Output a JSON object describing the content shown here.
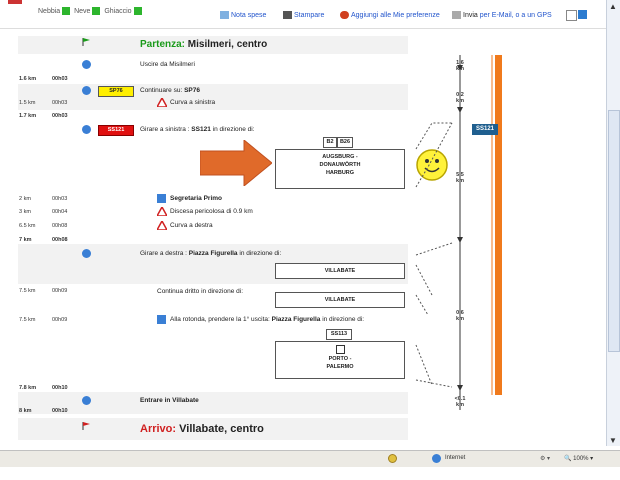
{
  "legend": {
    "fog": "Nebbia",
    "snow": "Neve",
    "ice": "Ghiaccio"
  },
  "toolbar": {
    "expense_note": "Nota spese",
    "print": "Stampare",
    "favorites": "Aggiungi alle Mie preferenze",
    "send_prefix": "Invia",
    "send_rest": "per E-Mail, o a un GPS"
  },
  "start": {
    "label": "Partenza:",
    "place": "Misilmeri, centro"
  },
  "steps": {
    "s1": {
      "text": "Uscire da Misilmeri",
      "km": "1.6 km",
      "time": "00h03"
    },
    "s2": {
      "tag": "SP76",
      "prefix": "Continuare su: ",
      "road": "SP76"
    },
    "s2a": {
      "km": "1.5 km",
      "time": "00h03",
      "text": "Curva a sinistra"
    },
    "s2b": {
      "km": "1.7 km",
      "time": "00h03"
    },
    "s3": {
      "tag": "SS121",
      "prefix": "Girare a sinistra : ",
      "road": "SS121",
      "suffix": " in direzione di:"
    },
    "s3box": {
      "r1": "B2",
      "r2": "B26",
      "l1": "AUGSBURG -",
      "l2": "DONAUWÖRTH",
      "l3": "HARBURG"
    },
    "s3a": {
      "km": "2 km",
      "time": "00h03",
      "text": "Segretaria Primo"
    },
    "s3b": {
      "km": "3 km",
      "time": "00h04",
      "text": "Discesa pericolosa di 0.9 km"
    },
    "s3c": {
      "km": "6.5 km",
      "time": "00h08",
      "text": "Curva a destra"
    },
    "s3d": {
      "km": "7 km",
      "time": "00h08"
    },
    "s4": {
      "prefix": "Girare a destra : ",
      "road": "Piazza Figurella",
      "suffix": " in direzione di:",
      "box": "VILLABATE"
    },
    "s5": {
      "km": "7.5 km",
      "time": "00h09",
      "text": "Continua dritto in direzione di:",
      "box": "VILLABATE"
    },
    "s6": {
      "km": "7.5 km",
      "time": "00h09",
      "prefix": "Alla rotonda, prendere la 1° uscita: ",
      "road": "Piazza Figurella",
      "suffix": " in direzione di:",
      "tag": "SS113",
      "l1": "PORTO -",
      "l2": "PALERMO"
    },
    "s7": {
      "km": "7.8 km",
      "time": "00h10",
      "text": "Entrare in Villabate"
    },
    "s7b": {
      "km": "8 km",
      "time": "00h10"
    }
  },
  "arrival": {
    "label": "Arrivo:",
    "place": "Villabate, centro"
  },
  "scale": {
    "a": [
      "1.6",
      "km"
    ],
    "b": [
      "0.2",
      "km"
    ],
    "c": [
      "5.5",
      "km"
    ],
    "d": [
      "0.6",
      "km"
    ],
    "e": [
      "<0.1",
      "km"
    ],
    "badge": "SS121"
  },
  "status": {
    "zone": "Internet",
    "zoom": "100%"
  },
  "colors": {
    "route": "#f07a1c",
    "info": "#3a7fd5",
    "green": "#1a9a1a",
    "red": "#d02020",
    "sp": "#ffef00",
    "ss": "#e01010",
    "badge": "#1f5f8f"
  }
}
